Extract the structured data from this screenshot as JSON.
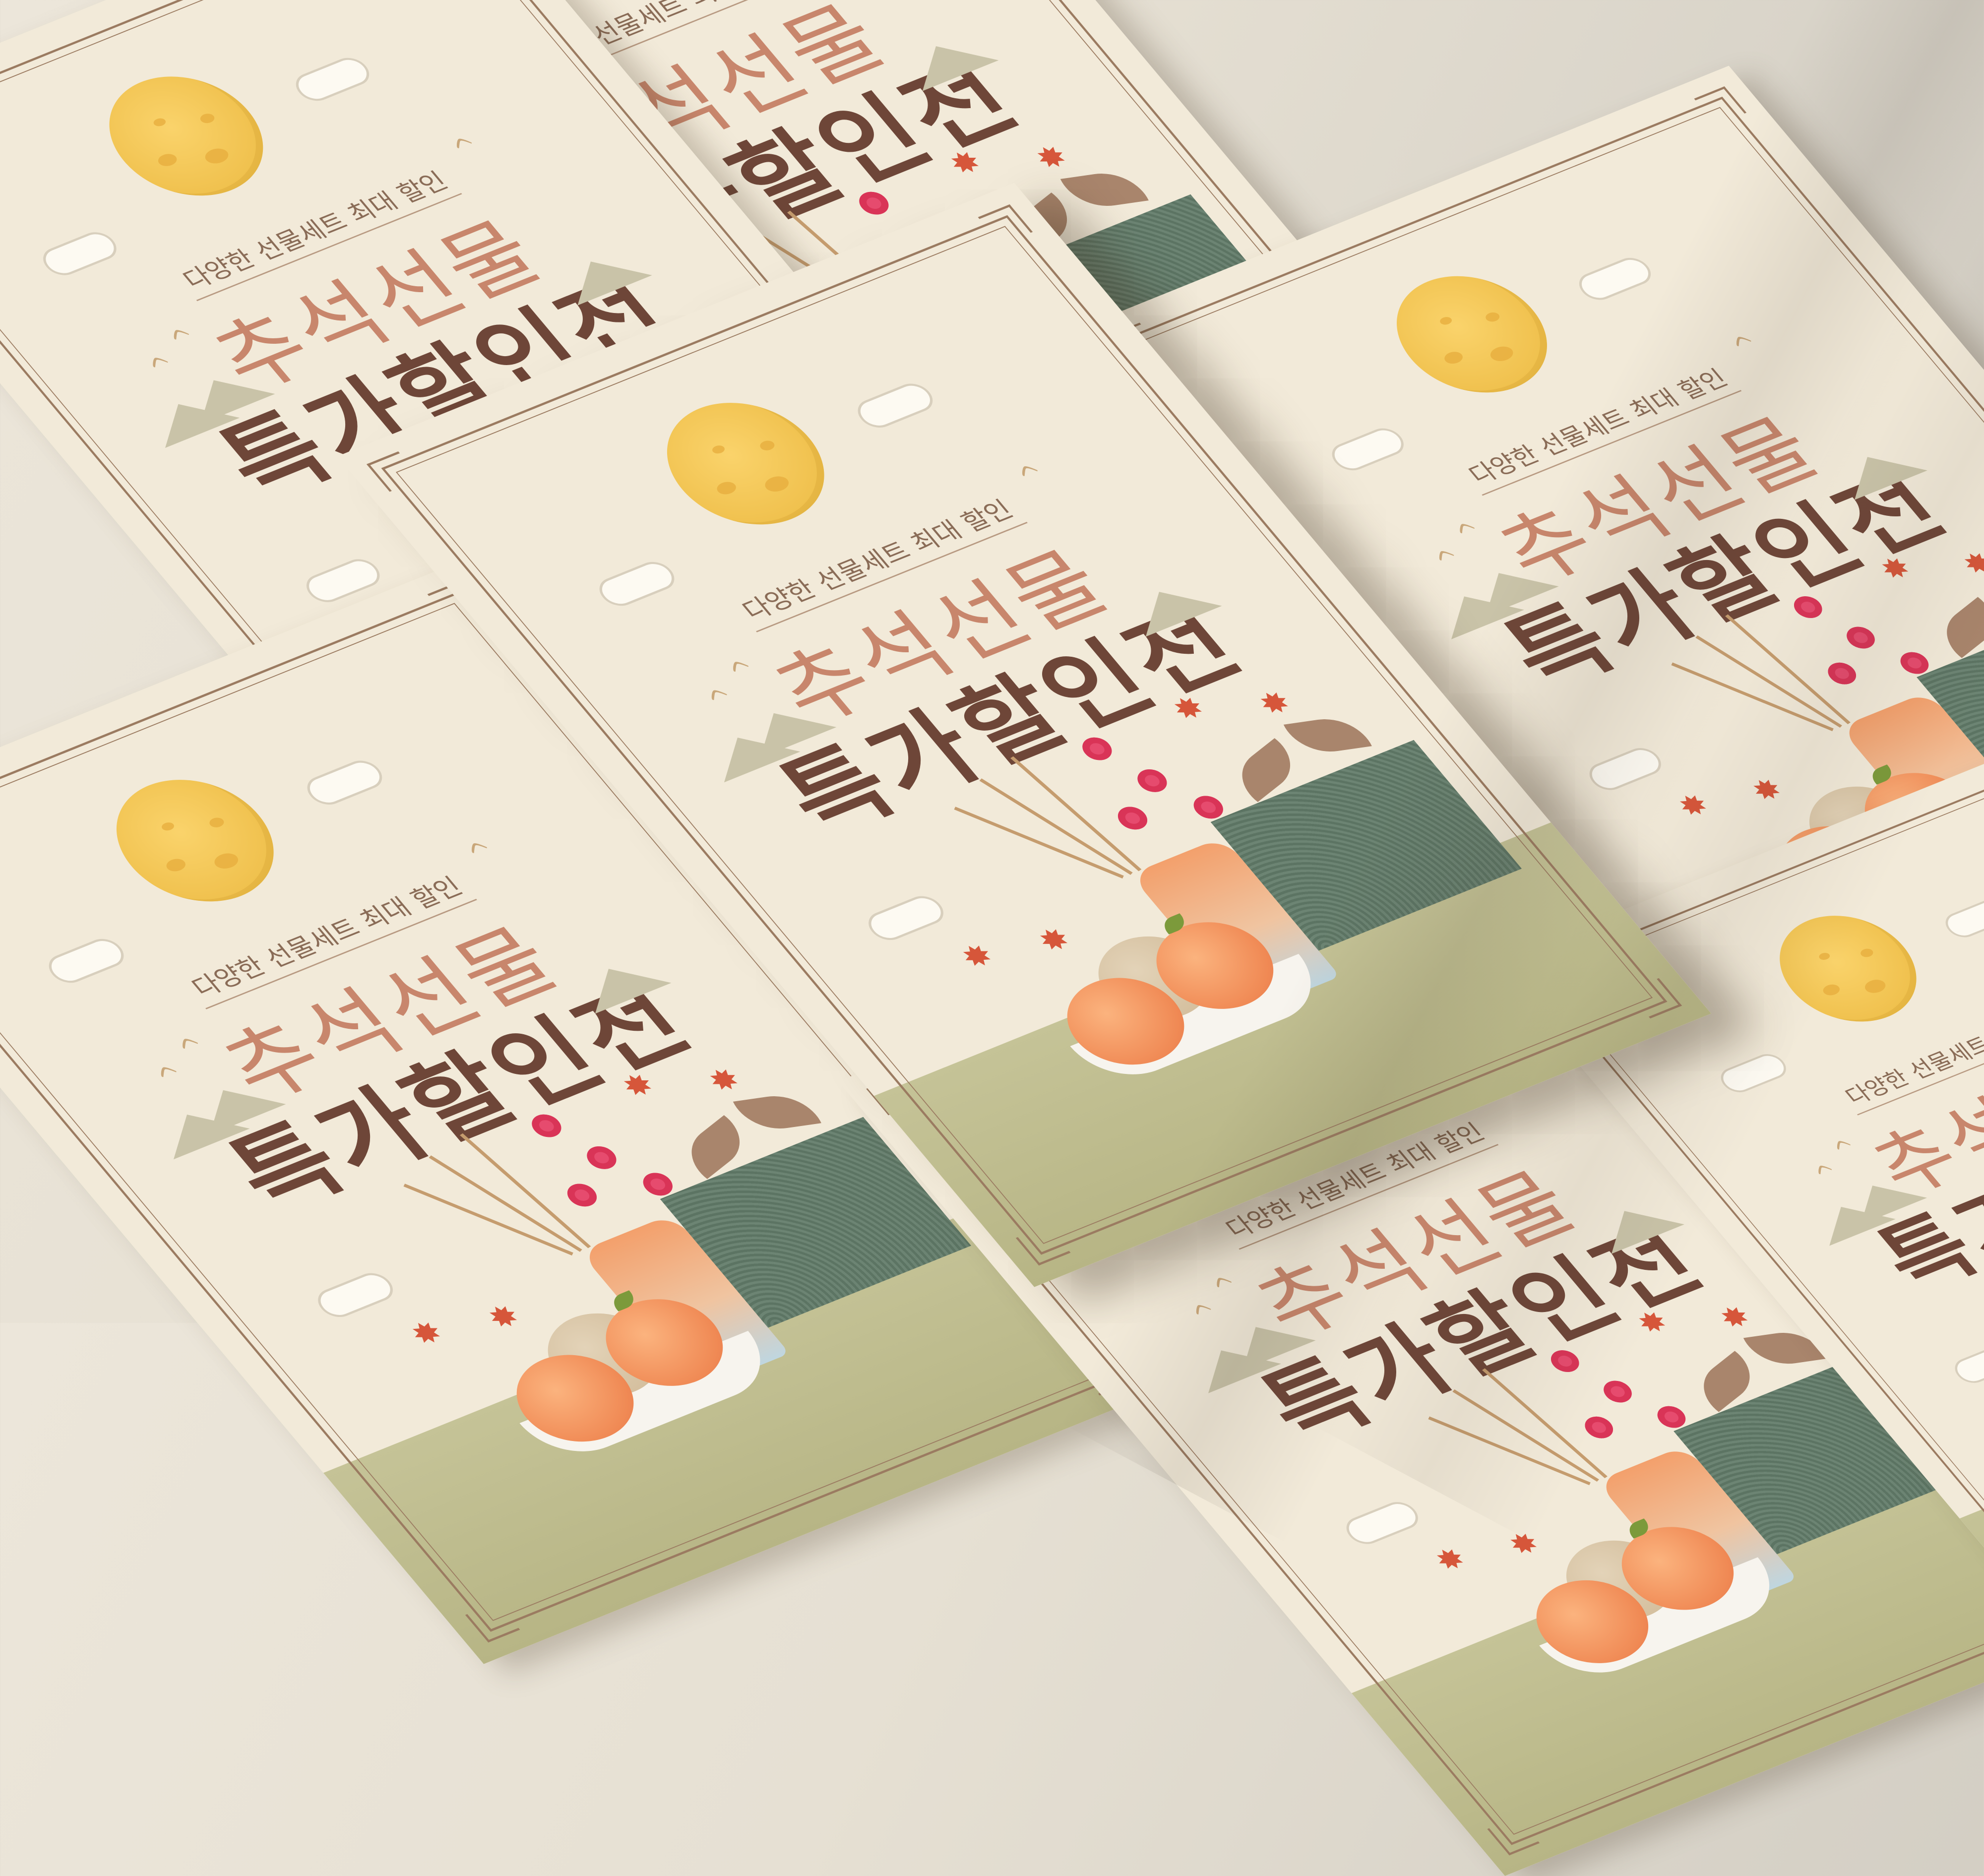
{
  "poster": {
    "subtitle": "다양한 선물세트 최대 할인",
    "title_line1": "추석선물",
    "title_line2": "특가할인전",
    "cloud_glyph": "☁",
    "maple_glyph": "✸",
    "bird_glyph": "ᨈ"
  },
  "colors": {
    "paper": "#f2ead9",
    "frame": "#9b7b61",
    "title_accent": "#c8866c",
    "title_dark": "#6e4638",
    "moon": "#f0c14e",
    "ground": "#c5c397",
    "bojagi": "#657c6b"
  },
  "icons": [
    "moon-icon",
    "cloud-icon",
    "maple-leaf-icon",
    "bird-icon",
    "mountain-icon",
    "bojagi-gift-icon",
    "vase-icon",
    "fruit-bowl-icon",
    "plum-blossom-icon",
    "grain-icon"
  ]
}
